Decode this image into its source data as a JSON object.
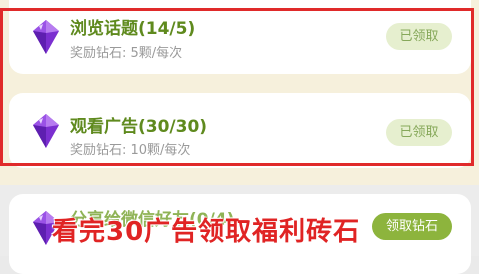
{
  "tasks": [
    {
      "title": "浏览话题(14/5)",
      "reward": "奖励钻石: 5颗/每次",
      "button_label": "已领取",
      "status": "claimed"
    },
    {
      "title": "观看广告(30/30)",
      "reward": "奖励钻石: 10颗/每次",
      "button_label": "已领取",
      "status": "claimed"
    },
    {
      "title": "分享给微信好友(0/4)",
      "button_label": "领取钻石",
      "status": "claimable"
    }
  ],
  "overlay": {
    "caption": "看完30广告领取福利砖石",
    "highlight_color": "#e02a2a"
  },
  "colors": {
    "title_green": "#5f8a1e",
    "claimed_bg": "#e6efcf",
    "claim_bg": "#8db43d",
    "gem_purple": "#8a3bd6"
  },
  "icons": {
    "task_icon": "purple-diamond-icon"
  }
}
